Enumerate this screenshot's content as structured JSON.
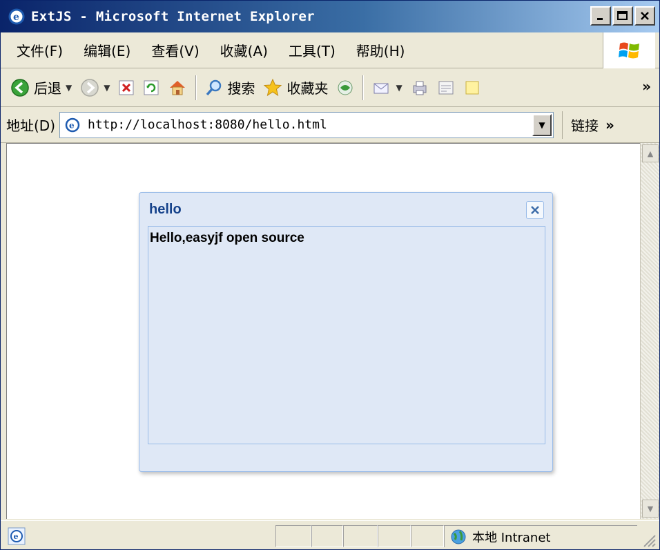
{
  "window": {
    "title": "ExtJS - Microsoft Internet Explorer"
  },
  "menu": {
    "items": [
      "文件(F)",
      "编辑(E)",
      "查看(V)",
      "收藏(A)",
      "工具(T)",
      "帮助(H)"
    ]
  },
  "toolbar": {
    "back_label": "后退",
    "search_label": "搜索",
    "favorites_label": "收藏夹",
    "more": "»"
  },
  "address": {
    "label": "地址(D)",
    "url": "http://localhost:8080/hello.html",
    "links_label": "链接",
    "links_more": "»"
  },
  "ext_window": {
    "title": "hello",
    "body_text": "Hello,easyjf open source"
  },
  "status": {
    "zone_text": "本地 Intranet"
  },
  "colors": {
    "titlebar_start": "#0a246a",
    "ext_header_text": "#15428b",
    "ext_bg": "#dfe8f6",
    "ext_border": "#99bbe8"
  }
}
